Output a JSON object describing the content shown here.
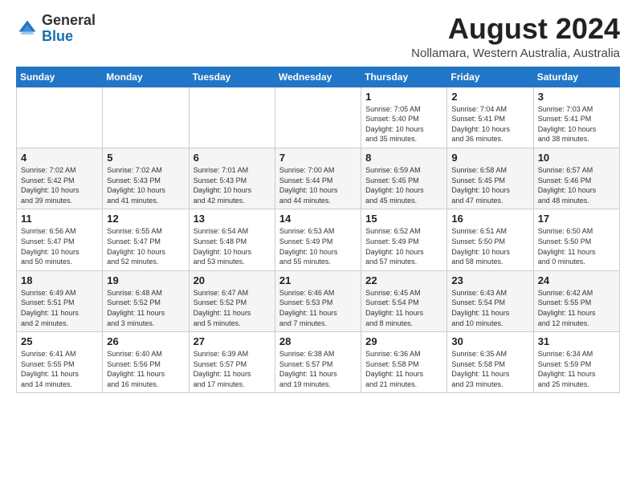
{
  "header": {
    "logo_general": "General",
    "logo_blue": "Blue",
    "month_year": "August 2024",
    "location": "Nollamara, Western Australia, Australia"
  },
  "weekdays": [
    "Sunday",
    "Monday",
    "Tuesday",
    "Wednesday",
    "Thursday",
    "Friday",
    "Saturday"
  ],
  "weeks": [
    [
      {
        "day": "",
        "info": ""
      },
      {
        "day": "",
        "info": ""
      },
      {
        "day": "",
        "info": ""
      },
      {
        "day": "",
        "info": ""
      },
      {
        "day": "1",
        "info": "Sunrise: 7:05 AM\nSunset: 5:40 PM\nDaylight: 10 hours\nand 35 minutes."
      },
      {
        "day": "2",
        "info": "Sunrise: 7:04 AM\nSunset: 5:41 PM\nDaylight: 10 hours\nand 36 minutes."
      },
      {
        "day": "3",
        "info": "Sunrise: 7:03 AM\nSunset: 5:41 PM\nDaylight: 10 hours\nand 38 minutes."
      }
    ],
    [
      {
        "day": "4",
        "info": "Sunrise: 7:02 AM\nSunset: 5:42 PM\nDaylight: 10 hours\nand 39 minutes."
      },
      {
        "day": "5",
        "info": "Sunrise: 7:02 AM\nSunset: 5:43 PM\nDaylight: 10 hours\nand 41 minutes."
      },
      {
        "day": "6",
        "info": "Sunrise: 7:01 AM\nSunset: 5:43 PM\nDaylight: 10 hours\nand 42 minutes."
      },
      {
        "day": "7",
        "info": "Sunrise: 7:00 AM\nSunset: 5:44 PM\nDaylight: 10 hours\nand 44 minutes."
      },
      {
        "day": "8",
        "info": "Sunrise: 6:59 AM\nSunset: 5:45 PM\nDaylight: 10 hours\nand 45 minutes."
      },
      {
        "day": "9",
        "info": "Sunrise: 6:58 AM\nSunset: 5:45 PM\nDaylight: 10 hours\nand 47 minutes."
      },
      {
        "day": "10",
        "info": "Sunrise: 6:57 AM\nSunset: 5:46 PM\nDaylight: 10 hours\nand 48 minutes."
      }
    ],
    [
      {
        "day": "11",
        "info": "Sunrise: 6:56 AM\nSunset: 5:47 PM\nDaylight: 10 hours\nand 50 minutes."
      },
      {
        "day": "12",
        "info": "Sunrise: 6:55 AM\nSunset: 5:47 PM\nDaylight: 10 hours\nand 52 minutes."
      },
      {
        "day": "13",
        "info": "Sunrise: 6:54 AM\nSunset: 5:48 PM\nDaylight: 10 hours\nand 53 minutes."
      },
      {
        "day": "14",
        "info": "Sunrise: 6:53 AM\nSunset: 5:49 PM\nDaylight: 10 hours\nand 55 minutes."
      },
      {
        "day": "15",
        "info": "Sunrise: 6:52 AM\nSunset: 5:49 PM\nDaylight: 10 hours\nand 57 minutes."
      },
      {
        "day": "16",
        "info": "Sunrise: 6:51 AM\nSunset: 5:50 PM\nDaylight: 10 hours\nand 58 minutes."
      },
      {
        "day": "17",
        "info": "Sunrise: 6:50 AM\nSunset: 5:50 PM\nDaylight: 11 hours\nand 0 minutes."
      }
    ],
    [
      {
        "day": "18",
        "info": "Sunrise: 6:49 AM\nSunset: 5:51 PM\nDaylight: 11 hours\nand 2 minutes."
      },
      {
        "day": "19",
        "info": "Sunrise: 6:48 AM\nSunset: 5:52 PM\nDaylight: 11 hours\nand 3 minutes."
      },
      {
        "day": "20",
        "info": "Sunrise: 6:47 AM\nSunset: 5:52 PM\nDaylight: 11 hours\nand 5 minutes."
      },
      {
        "day": "21",
        "info": "Sunrise: 6:46 AM\nSunset: 5:53 PM\nDaylight: 11 hours\nand 7 minutes."
      },
      {
        "day": "22",
        "info": "Sunrise: 6:45 AM\nSunset: 5:54 PM\nDaylight: 11 hours\nand 8 minutes."
      },
      {
        "day": "23",
        "info": "Sunrise: 6:43 AM\nSunset: 5:54 PM\nDaylight: 11 hours\nand 10 minutes."
      },
      {
        "day": "24",
        "info": "Sunrise: 6:42 AM\nSunset: 5:55 PM\nDaylight: 11 hours\nand 12 minutes."
      }
    ],
    [
      {
        "day": "25",
        "info": "Sunrise: 6:41 AM\nSunset: 5:55 PM\nDaylight: 11 hours\nand 14 minutes."
      },
      {
        "day": "26",
        "info": "Sunrise: 6:40 AM\nSunset: 5:56 PM\nDaylight: 11 hours\nand 16 minutes."
      },
      {
        "day": "27",
        "info": "Sunrise: 6:39 AM\nSunset: 5:57 PM\nDaylight: 11 hours\nand 17 minutes."
      },
      {
        "day": "28",
        "info": "Sunrise: 6:38 AM\nSunset: 5:57 PM\nDaylight: 11 hours\nand 19 minutes."
      },
      {
        "day": "29",
        "info": "Sunrise: 6:36 AM\nSunset: 5:58 PM\nDaylight: 11 hours\nand 21 minutes."
      },
      {
        "day": "30",
        "info": "Sunrise: 6:35 AM\nSunset: 5:58 PM\nDaylight: 11 hours\nand 23 minutes."
      },
      {
        "day": "31",
        "info": "Sunrise: 6:34 AM\nSunset: 5:59 PM\nDaylight: 11 hours\nand 25 minutes."
      }
    ]
  ]
}
